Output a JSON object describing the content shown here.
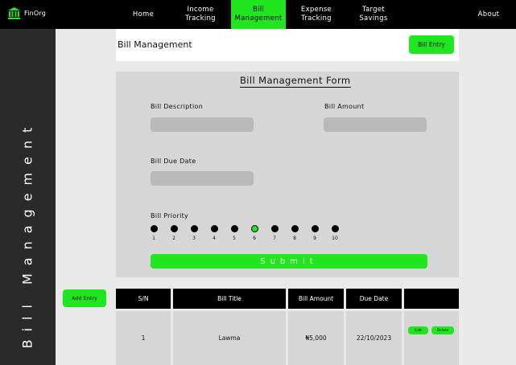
{
  "app": {
    "name": "FinOrg",
    "logo_icon": "bank-icon"
  },
  "nav": {
    "items": [
      {
        "label": "Home"
      },
      {
        "label": "Income\nTracking"
      },
      {
        "label": "Bill\nManagement",
        "active": true
      },
      {
        "label": "Expense\nTracking"
      },
      {
        "label": "Target\nSavings"
      },
      {
        "label": "About"
      }
    ]
  },
  "sidebar": {
    "title": "Bill Management"
  },
  "page": {
    "title": "Bill Management",
    "bill_entry_label": "Bill Entry"
  },
  "form": {
    "title": "Bill Management Form",
    "description": {
      "label": "Bill Description",
      "value": ""
    },
    "amount": {
      "label": "Bill Amount",
      "value": ""
    },
    "due_date": {
      "label": "Bill Due Date",
      "value": ""
    },
    "priority": {
      "label": "Bill Priority",
      "options": [
        "1",
        "2",
        "3",
        "4",
        "5",
        "6",
        "7",
        "8",
        "9",
        "10"
      ],
      "selected": "6"
    },
    "submit_label": "Submit"
  },
  "add_entry_label": "Add Entry",
  "table": {
    "headers": [
      "S/N",
      "Bill Title",
      "Bill Amount",
      "Due Date",
      ""
    ],
    "rows": [
      {
        "sn": "1",
        "title": "Lawma",
        "amount": "₦5,000",
        "due": "22/10/2023",
        "edit_label": "Edit",
        "delete_label": "Delete"
      }
    ]
  },
  "colors": {
    "accent": "#1fe61f",
    "bar": "#000000",
    "sidebar": "#2a2a2a",
    "panel": "#d6d6d6"
  }
}
